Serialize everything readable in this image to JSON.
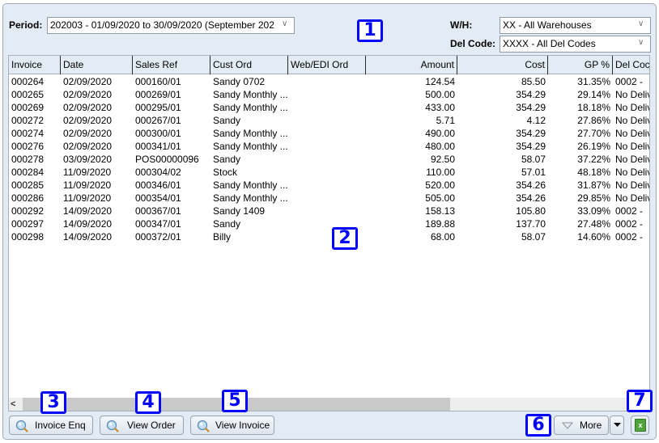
{
  "filters": {
    "period_label": "Period:",
    "period_value": "202003 - 01/09/2020 to 30/09/2020 (September 202",
    "wh_label": "W/H:",
    "wh_value": "XX - All Warehouses",
    "delcode_label": "Del Code:",
    "delcode_value": "XXXX - All Del Codes"
  },
  "badges": [
    "1",
    "2",
    "3",
    "4",
    "5",
    "6",
    "7"
  ],
  "table": {
    "columns": [
      "Invoice",
      "Date",
      "Sales Ref",
      "Cust Ord",
      "Web/EDI Ord",
      "Amount",
      "Cost",
      "GP %",
      "Del Coc"
    ],
    "rows": [
      [
        "000264",
        "02/09/2020",
        "000160/01",
        "Sandy 0702",
        "",
        "124.54",
        "85.50",
        "31.35%",
        "0002 -"
      ],
      [
        "000265",
        "02/09/2020",
        "000269/01",
        "Sandy Monthly ...",
        "",
        "500.00",
        "354.29",
        "29.14%",
        "No Deliv"
      ],
      [
        "000269",
        "02/09/2020",
        "000295/01",
        "Sandy Monthly ...",
        "",
        "433.00",
        "354.29",
        "18.18%",
        "No Deliv"
      ],
      [
        "000272",
        "02/09/2020",
        "000267/01",
        "Sandy",
        "",
        "5.71",
        "4.12",
        "27.86%",
        "No Deliv"
      ],
      [
        "000274",
        "02/09/2020",
        "000300/01",
        "Sandy Monthly ...",
        "",
        "490.00",
        "354.29",
        "27.70%",
        "No Deliv"
      ],
      [
        "000276",
        "02/09/2020",
        "000341/01",
        "Sandy Monthly ...",
        "",
        "480.00",
        "354.29",
        "26.19%",
        "No Deliv"
      ],
      [
        "000278",
        "03/09/2020",
        "POS00000096",
        "Sandy",
        "",
        "92.50",
        "58.07",
        "37.22%",
        "No Deliv"
      ],
      [
        "000284",
        "11/09/2020",
        "000304/02",
        "Stock",
        "",
        "110.00",
        "57.01",
        "48.18%",
        "No Deliv"
      ],
      [
        "000285",
        "11/09/2020",
        "000346/01",
        "Sandy Monthly ...",
        "",
        "520.00",
        "354.26",
        "31.87%",
        "No Deliv"
      ],
      [
        "000286",
        "11/09/2020",
        "000354/01",
        "Sandy Monthly ...",
        "",
        "505.00",
        "354.26",
        "29.85%",
        "No Deliv"
      ],
      [
        "000292",
        "14/09/2020",
        "000367/01",
        "Sandy 1409",
        "",
        "158.13",
        "105.80",
        "33.09%",
        "0002 -"
      ],
      [
        "000297",
        "14/09/2020",
        "000347/01",
        "Sandy",
        "",
        "189.88",
        "137.70",
        "27.48%",
        "0002 -"
      ],
      [
        "000298",
        "14/09/2020",
        "000372/01",
        "Billy",
        "",
        "68.00",
        "58.07",
        "14.60%",
        "0002 -"
      ]
    ]
  },
  "scrollbar": {
    "left_arrow": "<"
  },
  "buttons": {
    "invoice_enq": "Invoice Enq",
    "view_order": "View Order",
    "view_invoice": "View Invoice",
    "more": "More",
    "export_icon_glyph": "x"
  }
}
